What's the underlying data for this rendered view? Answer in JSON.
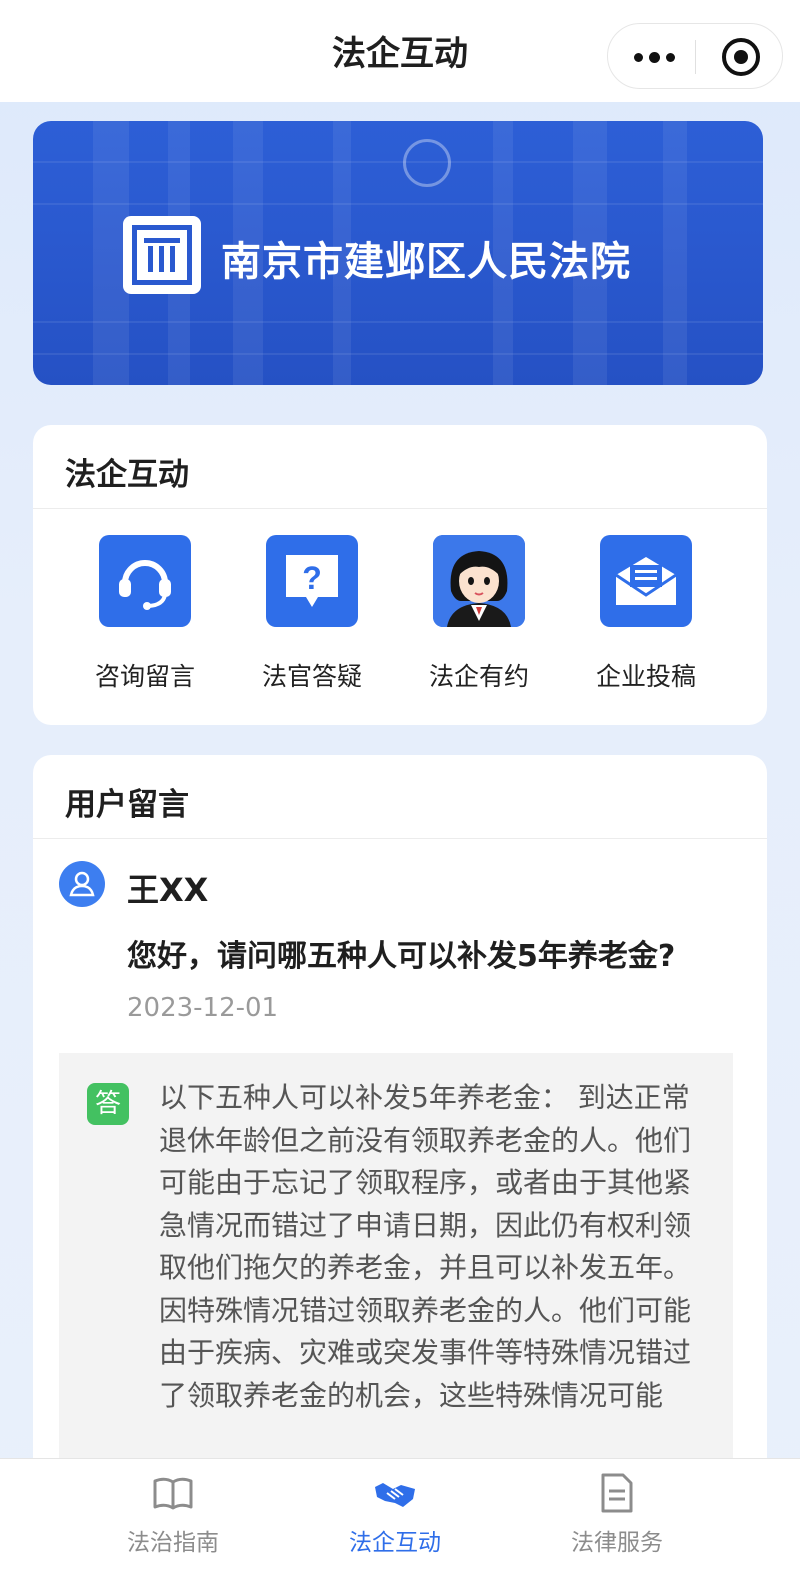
{
  "navbar": {
    "title": "法企互动",
    "more_icon": "more-dots-icon",
    "close_icon": "target-circle-icon"
  },
  "banner": {
    "court_name": "南京市建邺区人民法院",
    "logo_icon": "court-logo-icon"
  },
  "interaction": {
    "title": "法企互动",
    "items": [
      {
        "label": "咨询留言",
        "icon": "headset-icon"
      },
      {
        "label": "法官答疑",
        "icon": "question-bubble-icon"
      },
      {
        "label": "法企有约",
        "icon": "judge-avatar-icon"
      },
      {
        "label": "企业投稿",
        "icon": "mail-icon"
      }
    ]
  },
  "messages": {
    "title": "用户留言",
    "list": [
      {
        "user": "王XX",
        "question": "您好，请问哪五种人可以补发5年养老金?",
        "date": "2023-12-01",
        "answer_badge": "答",
        "answer": "以下五种人可以补发5年养老金： 到达正常退休年龄但之前没有领取养老金的人。他们可能由于忘记了领取程序，或者由于其他紧急情况而错过了申请日期，因此仍有权利领取他们拖欠的养老金，并且可以补发五年。 因特殊情况错过领取养老金的人。他们可能由于疾病、灾难或突发事件等特殊情况错过了领取养老金的机会，这些特殊情况可能"
      }
    ]
  },
  "tabbar": {
    "tabs": [
      {
        "label": "法治指南",
        "icon": "book-icon",
        "active": false
      },
      {
        "label": "法企互动",
        "icon": "handshake-icon",
        "active": true
      },
      {
        "label": "法律服务",
        "icon": "document-icon",
        "active": false
      }
    ]
  },
  "colors": {
    "accent": "#2f6ee9",
    "answer_badge": "#43c161",
    "banner": "#2a59cf"
  }
}
